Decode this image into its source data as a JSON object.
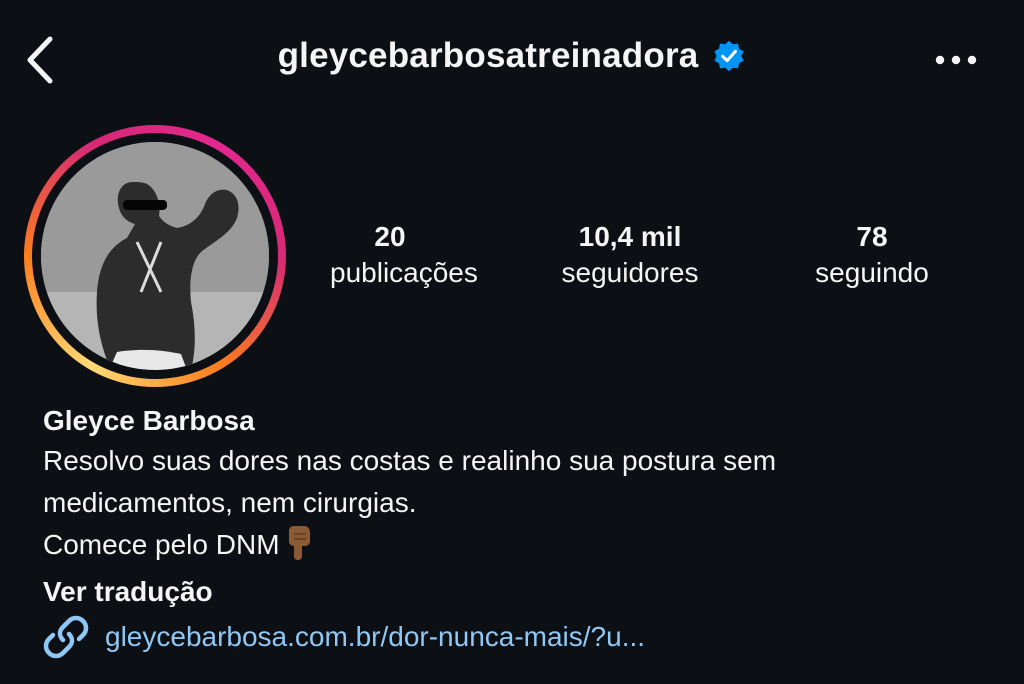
{
  "header": {
    "username": "gleycebarbosatreinadora",
    "verified": true
  },
  "stats": {
    "posts": {
      "value": "20",
      "label": "publicações"
    },
    "followers": {
      "value": "10,4 mil",
      "label": "seguidores"
    },
    "following": {
      "value": "78",
      "label": "seguindo"
    }
  },
  "profile": {
    "name": "Gleyce Barbosa",
    "bio_line1": "Resolvo suas dores nas costas e realinho sua postura sem",
    "bio_line2": "medicamentos, nem cirurgias.",
    "bio_line3": "Comece pelo DNM",
    "translate_label": "Ver tradução",
    "link": "gleycebarbosa.com.br/dor-nunca-mais/?u..."
  },
  "icons": {
    "back": "chevron-left-icon",
    "verified": "verified-badge-icon",
    "more": "more-horizontal-icon",
    "link": "link-icon",
    "pointing_down": "pointing-down-emoji"
  },
  "colors": {
    "background": "#0c1014",
    "text": "#f5f5f5",
    "link": "#8fc7f5",
    "verified": "#0095f6"
  }
}
